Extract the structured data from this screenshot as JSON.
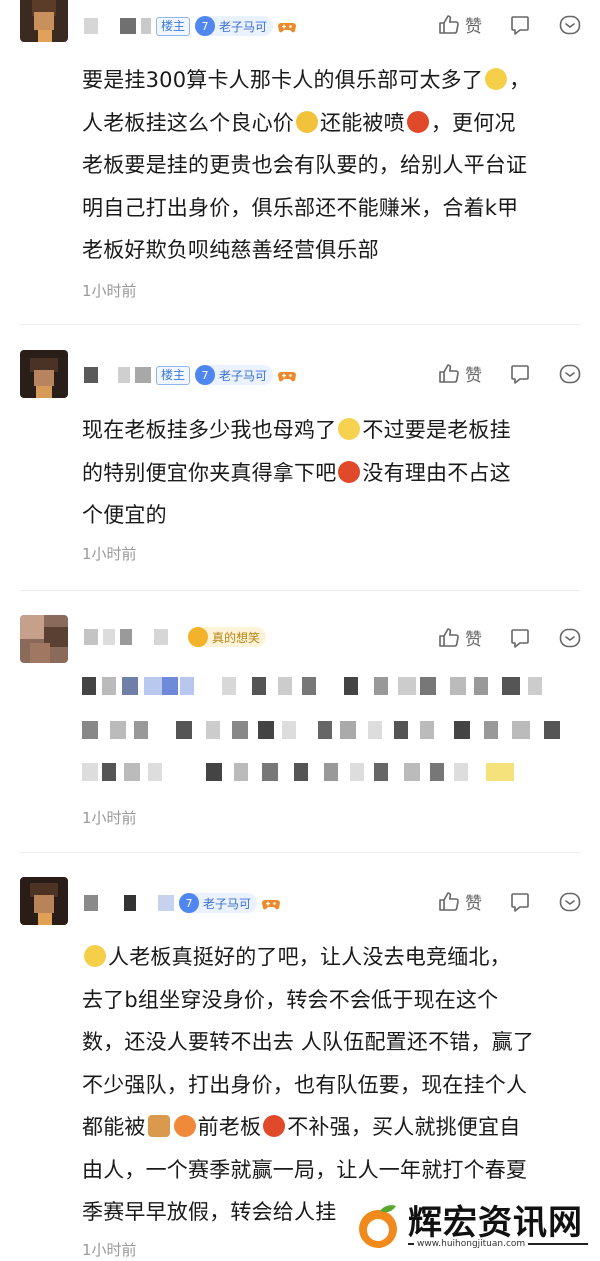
{
  "comments": [
    {
      "owner_badge": "楼主",
      "fan_level": "7",
      "fan_name": "老子马可",
      "like_label": "赞",
      "text_lines": [
        "要是挂300算卡人那卡人的俱乐部可太多了",
        "人老板挂这么个良心价",
        "还能被喷",
        "，更何况",
        "老板要是挂的更贵也会有队要的，给别人平台证",
        "明自己打出身价，俱乐部还不能赚米，合着k甲",
        "老板好欺负呗纯慈善经营俱乐部"
      ],
      "time": "1小时前"
    },
    {
      "owner_badge": "楼主",
      "fan_level": "7",
      "fan_name": "老子马可",
      "like_label": "赞",
      "text_lines": [
        "现在老板挂多少我也母鸡了",
        "不过要是老板挂",
        "的特别便宜你夹真得拿下吧",
        "没有理由不占这",
        "个便宜的"
      ],
      "time": "1小时前"
    },
    {
      "fan_level": "",
      "fan_name": "真的想笑",
      "like_label": "赞",
      "time": "1小时前"
    },
    {
      "fan_level": "7",
      "fan_name": "老子马可",
      "like_label": "赞",
      "text_lines": [
        "人老板真挺好的了吧，让人没去电竞缅北，",
        "去了b组坐穿没身价，转会不会低于现在这个",
        "数，还没人要转不出去 人队伍配置还不错，赢了",
        "不少强队，打出身价，也有队伍要，现在挂个人",
        "都能被",
        "前老板",
        "不补强，买人就挑便宜自",
        "由人，一个赛季就赢一局，让人一年就打个春夏",
        "季赛早早放假，转会给人挂"
      ],
      "time": "1小时前"
    }
  ],
  "icons": [
    "like-icon",
    "reply-icon",
    "more-icon"
  ],
  "watermark": {
    "brand": "辉宏资讯网",
    "url": "www.huihongjituan.com"
  }
}
